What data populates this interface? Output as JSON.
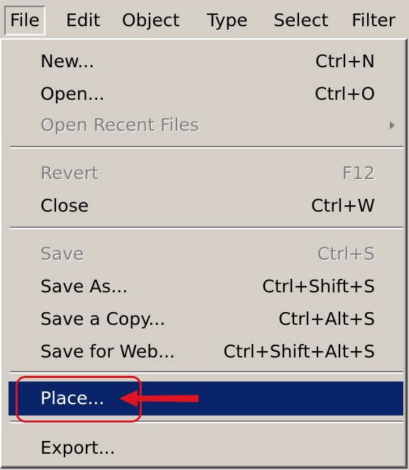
{
  "menubar": {
    "items": [
      {
        "label": "File",
        "active": true
      },
      {
        "label": "Edit"
      },
      {
        "label": "Object"
      },
      {
        "label": "Type"
      },
      {
        "label": "Select"
      },
      {
        "label": "Filter"
      }
    ]
  },
  "menu": {
    "items": [
      {
        "label": "New...",
        "shortcut": "Ctrl+N",
        "enabled": true
      },
      {
        "label": "Open...",
        "shortcut": "Ctrl+O",
        "enabled": true
      },
      {
        "label": "Open Recent Files",
        "shortcut": "",
        "enabled": false,
        "submenu": true
      },
      {
        "label": "Revert",
        "shortcut": "F12",
        "enabled": false
      },
      {
        "label": "Close",
        "shortcut": "Ctrl+W",
        "enabled": true
      },
      {
        "label": "Save",
        "shortcut": "Ctrl+S",
        "enabled": false
      },
      {
        "label": "Save As...",
        "shortcut": "Ctrl+Shift+S",
        "enabled": true
      },
      {
        "label": "Save a Copy...",
        "shortcut": "Ctrl+Alt+S",
        "enabled": true
      },
      {
        "label": "Save for Web...",
        "shortcut": "Ctrl+Shift+Alt+S",
        "enabled": true
      },
      {
        "label": "Place...",
        "shortcut": "",
        "enabled": true,
        "highlighted": true
      },
      {
        "label": "Export...",
        "shortcut": "",
        "enabled": true
      }
    ]
  },
  "colors": {
    "menu_background": "#d4d0c8",
    "highlight": "#0a246a",
    "highlight_text": "#ffffff",
    "disabled_text": "#808080",
    "annotation": "#e0141e"
  }
}
